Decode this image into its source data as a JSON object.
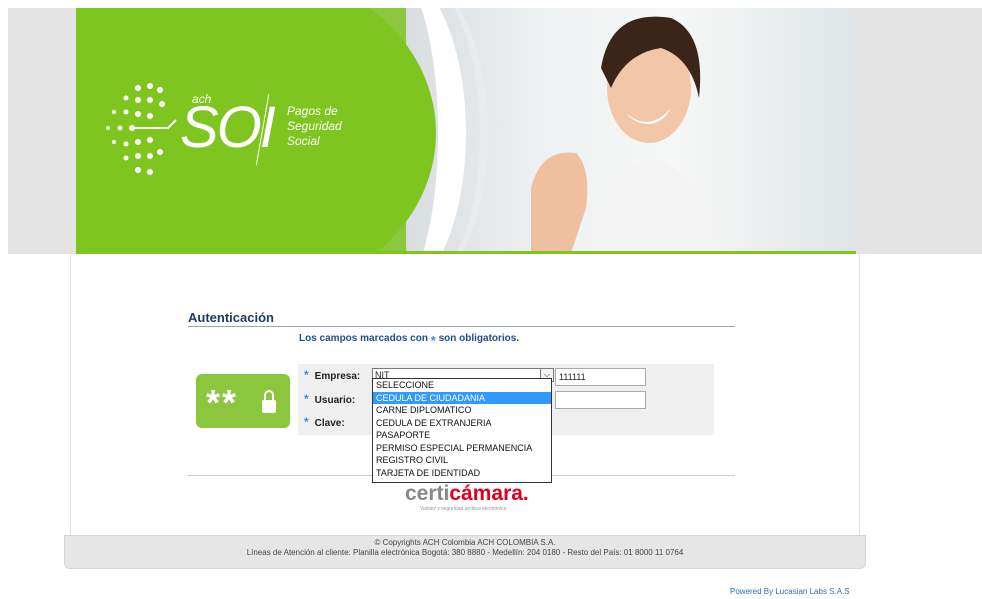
{
  "banner": {
    "logo_ach": "ach",
    "logo_soi": "SOI",
    "logo_tagline": "Pagos de Seguridad Social"
  },
  "auth": {
    "title": "Autenticación",
    "required_note_before": "Los campos marcados con",
    "required_star": "*",
    "required_note_after": "son obligatorios.",
    "empresa_label": "Empresa:",
    "usuario_label": "Usuario:",
    "clave_label": "Clave:",
    "doc_type_selected": "NIT",
    "empresa_value": "111111",
    "usuario_value": "",
    "doc_type_options": [
      "SELECCIONE",
      "CEDULA DE CIUDADANIA",
      "CARNE DIPLOMATICO",
      "CEDULA DE EXTRANJERIA",
      "PASAPORTE",
      "PERMISO ESPECIAL PERMANENCIA",
      "REGISTRO CIVIL",
      "TARJETA DE IDENTIDAD"
    ],
    "highlighted_option": "CEDULA DE CIUDADANIA",
    "lock_badge_text": "**"
  },
  "certicamara": {
    "part1": "certi",
    "part2": "cámara.",
    "subtitle": "Validez y seguridad jurídica electrónica"
  },
  "footer": {
    "copyright": "© Copyrights ACH Colombia ACH COLOMBIA S.A.",
    "lines": "Líneas de Atención al cliente: Planilla electrónica Bogotá: 380 8880 - Medellín: 204 0180 - Resto del País: 01 8000 11 0764"
  },
  "powered_by": "Powered By Lucasian Labs S.A.S",
  "colors": {
    "brand_green": "#7fc520",
    "link_blue": "#2f6fc3",
    "select_highlight": "#3399ff",
    "certicamara_red": "#e0001b"
  }
}
